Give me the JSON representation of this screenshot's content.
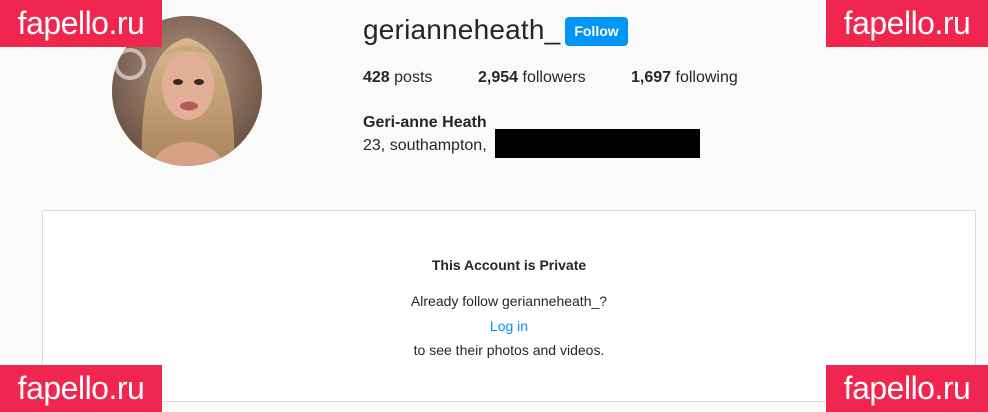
{
  "profile": {
    "username": "gerianneheath_",
    "follow_label": "Follow",
    "stats": {
      "posts_count": "428",
      "posts_label": "posts",
      "followers_count": "2,954",
      "followers_label": "followers",
      "following_count": "1,697",
      "following_label": "following"
    },
    "full_name": "Geri-anne Heath",
    "bio": "23, southampton,"
  },
  "private_notice": {
    "title": "This Account is Private",
    "prompt": "Already follow gerianneheath_?",
    "login_label": "Log in",
    "subtext": "to see their photos and videos."
  },
  "watermark": {
    "text": "fapello.ru"
  },
  "colors": {
    "accent": "#0095f6",
    "watermark_bg": "#f0264f",
    "page_bg": "#fafafa"
  }
}
